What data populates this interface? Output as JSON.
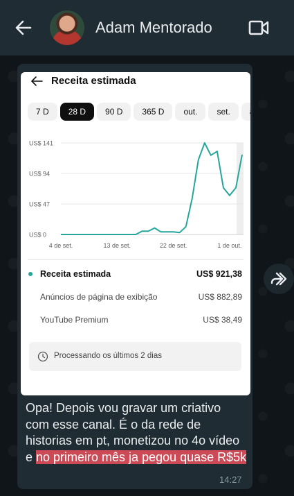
{
  "header": {
    "contact_name": "Adam Mentorado",
    "back_icon": "arrow-left-icon",
    "video_icon": "video-camera-icon"
  },
  "colors": {
    "header_bg": "#1f2c33",
    "bubble_bg": "#1f2c33",
    "highlight": "#cc4a56",
    "chart_line": "#26a69a"
  },
  "screenshot": {
    "title": "Receita estimada",
    "chips": [
      "7 D",
      "28 D",
      "90 D",
      "365 D",
      "out.",
      "set.",
      "ag"
    ],
    "active_chip": "28 D",
    "legend": {
      "main_label": "Receita estimada",
      "main_value": "US$ 921,38",
      "row_a_label": "Anúncios de página de exibição",
      "row_a_value": "US$ 882,89",
      "row_b_label": "YouTube Premium",
      "row_b_value": "US$ 38,49"
    },
    "processing_text": "Processando os últimos 2 dias"
  },
  "chart_data": {
    "type": "line",
    "title": "",
    "xlabel": "",
    "ylabel": "",
    "y_ticks": [
      "US$ 141",
      "US$ 94",
      "US$ 47",
      "US$ 0"
    ],
    "ylim": [
      0,
      141
    ],
    "x_ticks": [
      "4 de set.",
      "13 de set.",
      "22 de set.",
      "1 de out."
    ],
    "series": [
      {
        "values": [
          0,
          0,
          0,
          0,
          0,
          0,
          0,
          0,
          0,
          0,
          0,
          0,
          0,
          5,
          5,
          10,
          4,
          4,
          4,
          3,
          12,
          55,
          115,
          141,
          122,
          128,
          72,
          60,
          72,
          123
        ]
      }
    ],
    "grid": true
  },
  "message": {
    "text_plain": "Opa! Depois vou gravar um criativo com esse canal. É o da rede de historias em pt, monetizou no 4o vídeo e ",
    "text_highlight": "no primeiro mês ja pegou quase R$5k",
    "time": "14:27"
  },
  "forward_icon": "forward-icon"
}
